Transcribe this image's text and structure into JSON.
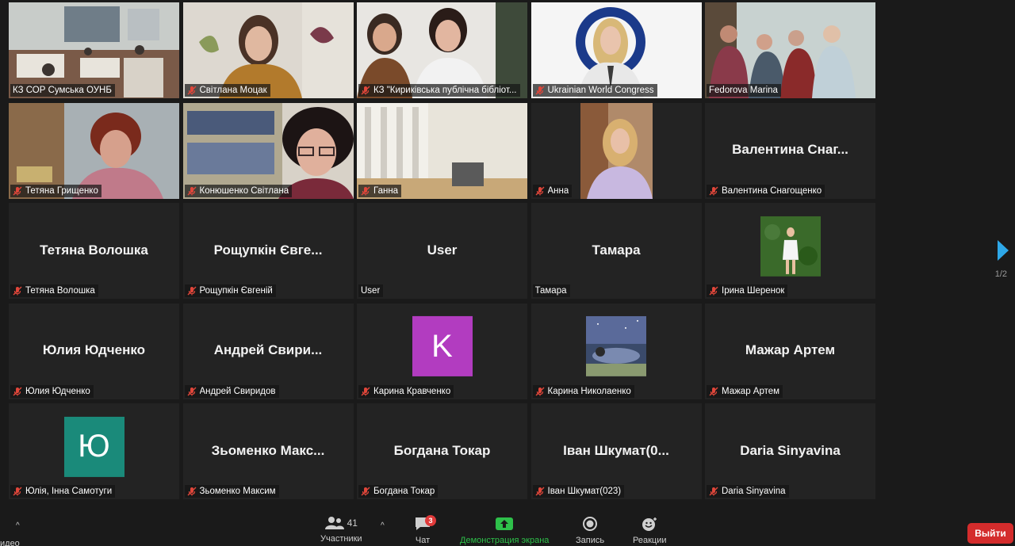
{
  "tiles": [
    {
      "name": "КЗ СОР Сумська ОУНБ",
      "type": "video",
      "scene": "library-room",
      "active": true,
      "muted": false
    },
    {
      "name": "Світлана Моцак",
      "type": "video",
      "scene": "woman-plants",
      "muted": true
    },
    {
      "name": "КЗ \"Кириківська публічна бібліот...",
      "type": "video",
      "scene": "two-women",
      "muted": true
    },
    {
      "name": "Ukrainian World Congress",
      "type": "video",
      "scene": "uwc-logo",
      "muted": true
    },
    {
      "name": "Fedorova Marina",
      "type": "video",
      "scene": "group",
      "muted": false
    },
    {
      "name": "Тетяна Грищенко",
      "type": "video",
      "scene": "woman-redhair",
      "muted": true
    },
    {
      "name": "Конюшенко Світлана",
      "type": "video",
      "scene": "woman-glasses",
      "muted": true
    },
    {
      "name": "Ганна",
      "type": "video",
      "scene": "window-room",
      "muted": true
    },
    {
      "name": "Анна",
      "type": "video",
      "scene": "girl-blonde",
      "muted": true
    },
    {
      "name": "Валентина Снагощенко",
      "type": "name",
      "display": "Валентина  Снаг...",
      "muted": true
    },
    {
      "name": "Тетяна Волошка",
      "type": "name",
      "display": "Тетяна Волошка",
      "muted": true
    },
    {
      "name": "Рощупкін Євгеній",
      "type": "name",
      "display": "Рощупкін  Євге...",
      "muted": true
    },
    {
      "name": "User",
      "type": "name",
      "display": "User",
      "muted": false
    },
    {
      "name": "Тамара",
      "type": "name",
      "display": "Тамара",
      "muted": false
    },
    {
      "name": "Ірина Шеренок",
      "type": "photo",
      "scene": "girl-white-dress",
      "muted": true
    },
    {
      "name": "Юлия Юдченко",
      "type": "name",
      "display": "Юлия  Юдченко",
      "muted": true
    },
    {
      "name": "Андрей Свиридов",
      "type": "name",
      "display": "Андрей  Свири...",
      "muted": true
    },
    {
      "name": "Карина Кравченко",
      "type": "avatar",
      "letter": "K",
      "color": "#b23cc0",
      "muted": true
    },
    {
      "name": "Карина Николаенко",
      "type": "photo",
      "scene": "sleeping-girl",
      "muted": true
    },
    {
      "name": "Мажар Артем",
      "type": "name",
      "display": "Мажар  Артем",
      "muted": true
    },
    {
      "name": "Юлія, Інна Самотуги",
      "type": "avatar",
      "letter": "Ю",
      "color": "#1a8a7a",
      "muted": true
    },
    {
      "name": "Зьоменко Максим",
      "type": "name",
      "display": "Зьоменко  Макс...",
      "muted": true
    },
    {
      "name": "Богдана Токар",
      "type": "name",
      "display": "Богдана  Токар",
      "muted": true
    },
    {
      "name": "Іван Шкумат(023)",
      "type": "name",
      "display": "Іван  Шкумат(0...",
      "muted": true
    },
    {
      "name": "Daria Sinyavina",
      "type": "name",
      "display": "Daria Sinyavina",
      "muted": true
    }
  ],
  "pager": {
    "indicator": "1/2"
  },
  "toolbar": {
    "video_label": "идео",
    "participants_label": "Участники",
    "participants_count": "41",
    "chat_label": "Чат",
    "chat_badge": "3",
    "share_label": "Демонстрация экрана",
    "record_label": "Запись",
    "reactions_label": "Реакции",
    "leave_label": "Выйти"
  },
  "colors": {
    "active_border": "#d6d65a",
    "share_green": "#2ec04a",
    "leave_red": "#d42c2c",
    "mute_red": "#e0463a",
    "arrow_blue": "#2ea8e8"
  }
}
